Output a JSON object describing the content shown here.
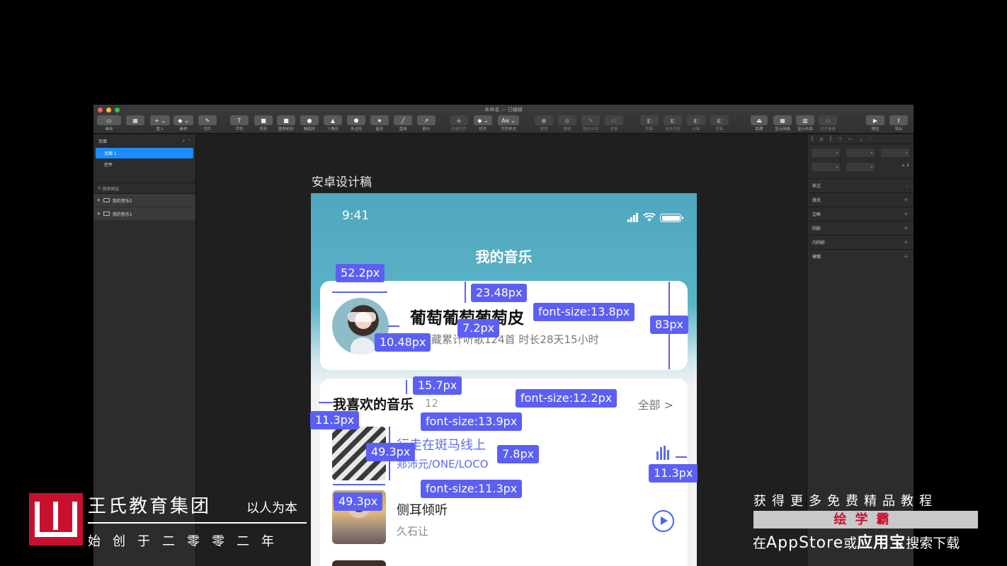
{
  "window": {
    "title": "未命名 — 已编辑"
  },
  "toolbar": [
    {
      "label": "画布",
      "glyph": "▭"
    },
    {
      "label": "",
      "glyph": "▦"
    },
    {
      "label": "置入",
      "glyph": "+ ⌄"
    },
    {
      "label": "素材",
      "glyph": "◆ ⌄"
    },
    {
      "label": "切片",
      "glyph": "✎"
    },
    {
      "label": "字符",
      "glyph": "T"
    },
    {
      "label": "矩形",
      "glyph": "■"
    },
    {
      "label": "圆角矩形",
      "glyph": "■"
    },
    {
      "label": "椭圆形",
      "glyph": "●"
    },
    {
      "label": "三角形",
      "glyph": "▲"
    },
    {
      "label": "多边形",
      "glyph": "⬟"
    },
    {
      "label": "星形",
      "glyph": "★"
    },
    {
      "label": "直线",
      "glyph": "╱"
    },
    {
      "label": "箭头",
      "glyph": "↗"
    },
    {
      "label": "创建控件",
      "glyph": "◆"
    },
    {
      "label": "控件",
      "glyph": "◆ ⌄"
    },
    {
      "label": "字符样式",
      "glyph": "Aa ⌄"
    },
    {
      "label": "蒙版",
      "glyph": "●"
    },
    {
      "label": "模糊",
      "glyph": "◍"
    },
    {
      "label": "路径合并",
      "glyph": "✎"
    },
    {
      "label": "变换",
      "glyph": "▭"
    },
    {
      "label": "联集",
      "glyph": "◧"
    },
    {
      "label": "减去顶层",
      "glyph": "◧"
    },
    {
      "label": "交集",
      "glyph": "◧"
    },
    {
      "label": "差集",
      "glyph": "◧"
    },
    {
      "label": "助理",
      "glyph": "⏏"
    },
    {
      "label": "显示网格",
      "glyph": "▦"
    },
    {
      "label": "显示布局",
      "glyph": "▥"
    },
    {
      "label": "对齐像素",
      "glyph": "▭"
    },
    {
      "label": "预览",
      "glyph": "▶"
    },
    {
      "label": "导出",
      "glyph": "⇪"
    }
  ],
  "left_panel": {
    "pages_heading": "页面",
    "pages": [
      "页面 1",
      "控件"
    ],
    "search_placeholder": "搜索图层",
    "layers": [
      "我的音乐2",
      "我的音乐1"
    ]
  },
  "right_panel": {
    "style_label": "样式",
    "rows": [
      "填充",
      "边框",
      "阴影",
      "内阴影",
      "模糊"
    ]
  },
  "artboard": {
    "label": "安卓设计稿",
    "status_time": "9:41",
    "nav_title": "我的音乐",
    "profile": {
      "name": "葡萄葡萄葡萄皮",
      "stats": "已收藏累计听歌124首  时长28天15小时"
    },
    "favorites": {
      "title": "我喜欢的音乐",
      "count": "12",
      "all_label": "全部 >",
      "songs": [
        {
          "name": "行走在斑马线上",
          "artist": "郑沛元/ONE/LOCO"
        },
        {
          "name": "侧耳倾听",
          "artist": "久石让"
        }
      ]
    }
  },
  "measurements": [
    "52.2px",
    "23.48px",
    "font-size:13.8px",
    "83px",
    "7.2px",
    "10.48px",
    "15.7px",
    "font-size:12.2px",
    "11.3px",
    "font-size:13.9px",
    "49.3px",
    "7.8px",
    "11.3px",
    "font-size:11.3px",
    "49.3px"
  ],
  "colors": {
    "accent": "#5c5ff4",
    "brand_red": "#c8102e",
    "selection_blue": "#1a8cff"
  },
  "watermark": {
    "org": "王氏教育集团",
    "slogan": "以人为本",
    "founded": "始创于二零零二年",
    "promo_line1": "获得更多免费精品教程",
    "brand": "绘学霸",
    "promo_line3_prefix": "在",
    "promo_line3_store": "AppStore",
    "promo_line3_mid": "或",
    "promo_line3_app": "应用宝",
    "promo_line3_suffix": "搜索下载"
  }
}
